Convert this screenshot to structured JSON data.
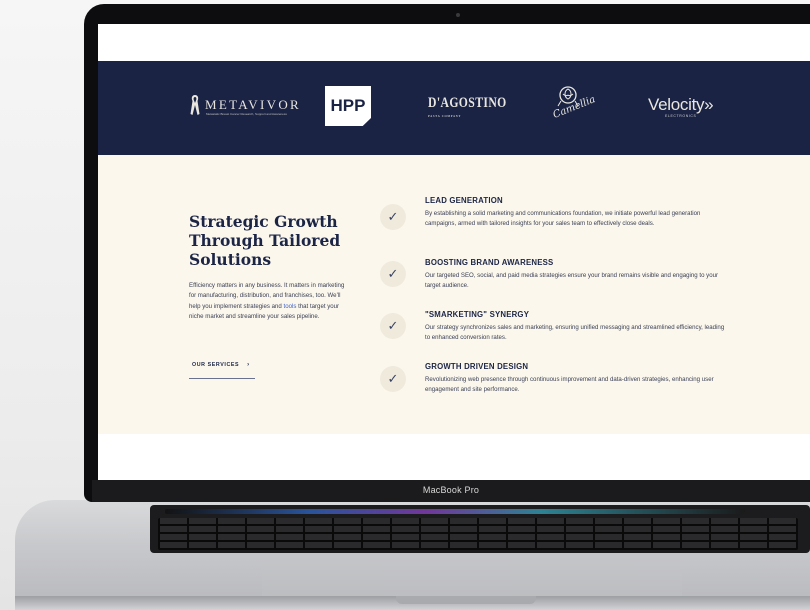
{
  "device": {
    "label": "MacBook Pro"
  },
  "logos": {
    "metavivor": "METAVIVOR",
    "metavivor_tagline": "Metastatic Breast Cancer Research, Support and Awareness",
    "hpp": "HPP",
    "dagostino": "D'AGOSTINO",
    "dagostino_tagline": "PASTA COMPANY",
    "camellia": "Camellia",
    "velocity": "Velocity»",
    "velocity_tagline": "ELECTRONICS"
  },
  "section": {
    "heading": "Strategic Growth Through Tailored Solutions",
    "intro_before": "Efficiency matters in any business. It matters in marketing for manufacturing, distribution, and franchises, too. We'll help you implement strategies and ",
    "intro_link": "tools",
    "intro_after": " that target your niche market and streamline your sales pipeline.",
    "services_label": "OUR SERVICES",
    "services_chevron": "›"
  },
  "items": [
    {
      "check": "✓",
      "title": "LEAD GENERATION",
      "text": "By establishing a solid marketing and communications foundation, we initiate powerful lead generation campaigns, armed with tailored insights for your sales team to effectively close deals."
    },
    {
      "check": "✓",
      "title": "BOOSTING BRAND AWARENESS",
      "text": "Our targeted SEO, social, and paid media strategies ensure your brand remains visible and engaging to your target audience."
    },
    {
      "check": "✓",
      "title": "\"SMARKETING\" SYNERGY",
      "text": "Our strategy synchronizes sales and marketing, ensuring unified messaging and streamlined efficiency, leading to enhanced conversion rates."
    },
    {
      "check": "✓",
      "title": "GROWTH DRIVEN DESIGN",
      "text": "Revolutionizing web presence through continuous improvement and data-driven strategies, enhancing user engagement and site performance."
    }
  ],
  "colors": {
    "navy": "#1a2344",
    "cream": "#fbf7ec",
    "link": "#3e62c9"
  }
}
